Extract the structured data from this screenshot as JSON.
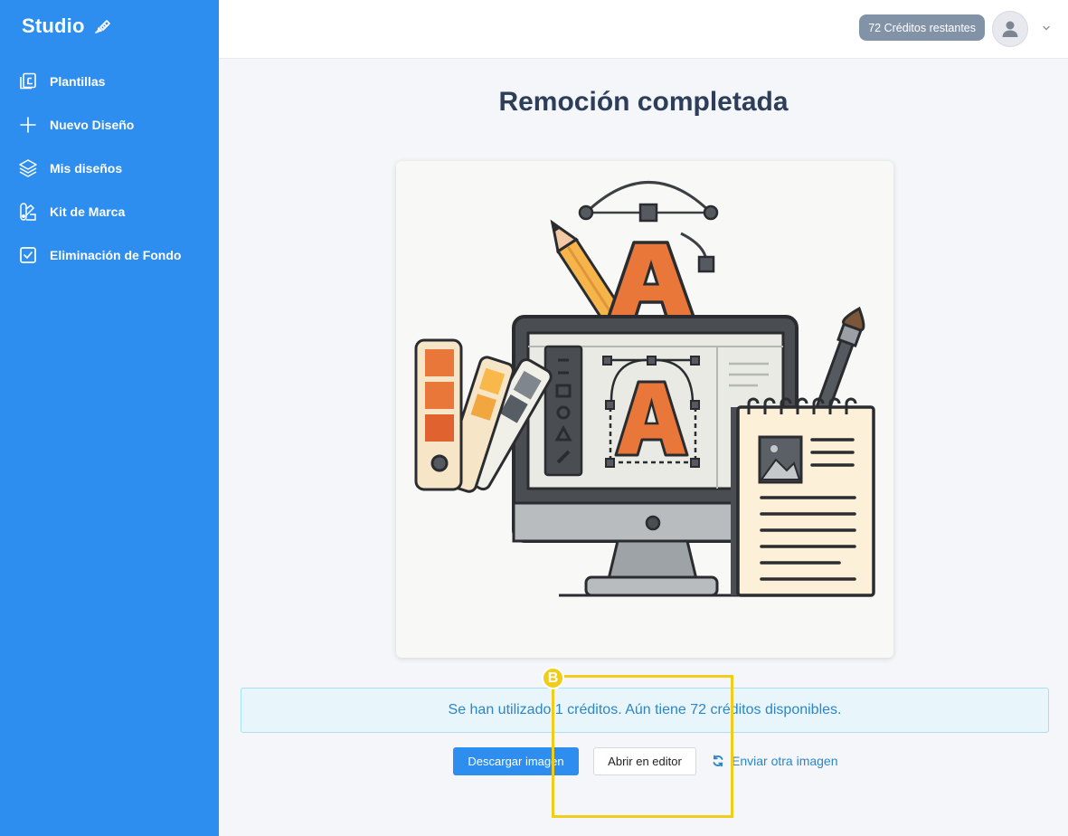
{
  "app": {
    "name": "Studio"
  },
  "sidebar": {
    "items": [
      {
        "label": "Plantillas",
        "icon": "templates-icon"
      },
      {
        "label": "Nuevo Diseño",
        "icon": "plus-icon"
      },
      {
        "label": "Mis diseños",
        "icon": "layers-icon"
      },
      {
        "label": "Kit de Marca",
        "icon": "brand-kit-icon"
      },
      {
        "label": "Eliminación de Fondo",
        "icon": "checkbox-icon"
      }
    ]
  },
  "header": {
    "credits_label": "72 Créditos restantes"
  },
  "main": {
    "title": "Remoción completada",
    "alert": "Se han utilizado 1 créditos. Aún tiene 72 créditos disponibles.",
    "download_button": "Descargar imagen",
    "editor_button": "Abrir en editor",
    "resend_link": "Enviar otra imagen"
  },
  "annotation": {
    "badge": "B"
  },
  "colors": {
    "primary": "#2d8ef0",
    "title": "#2c3e5a",
    "alert_bg": "#e8f6fc",
    "alert_text": "#2a86c9",
    "badge": "#8393a7",
    "marker": "#f2cc1b",
    "illustration_orange": "#e9773a",
    "illustration_dark": "#3d3f42"
  }
}
